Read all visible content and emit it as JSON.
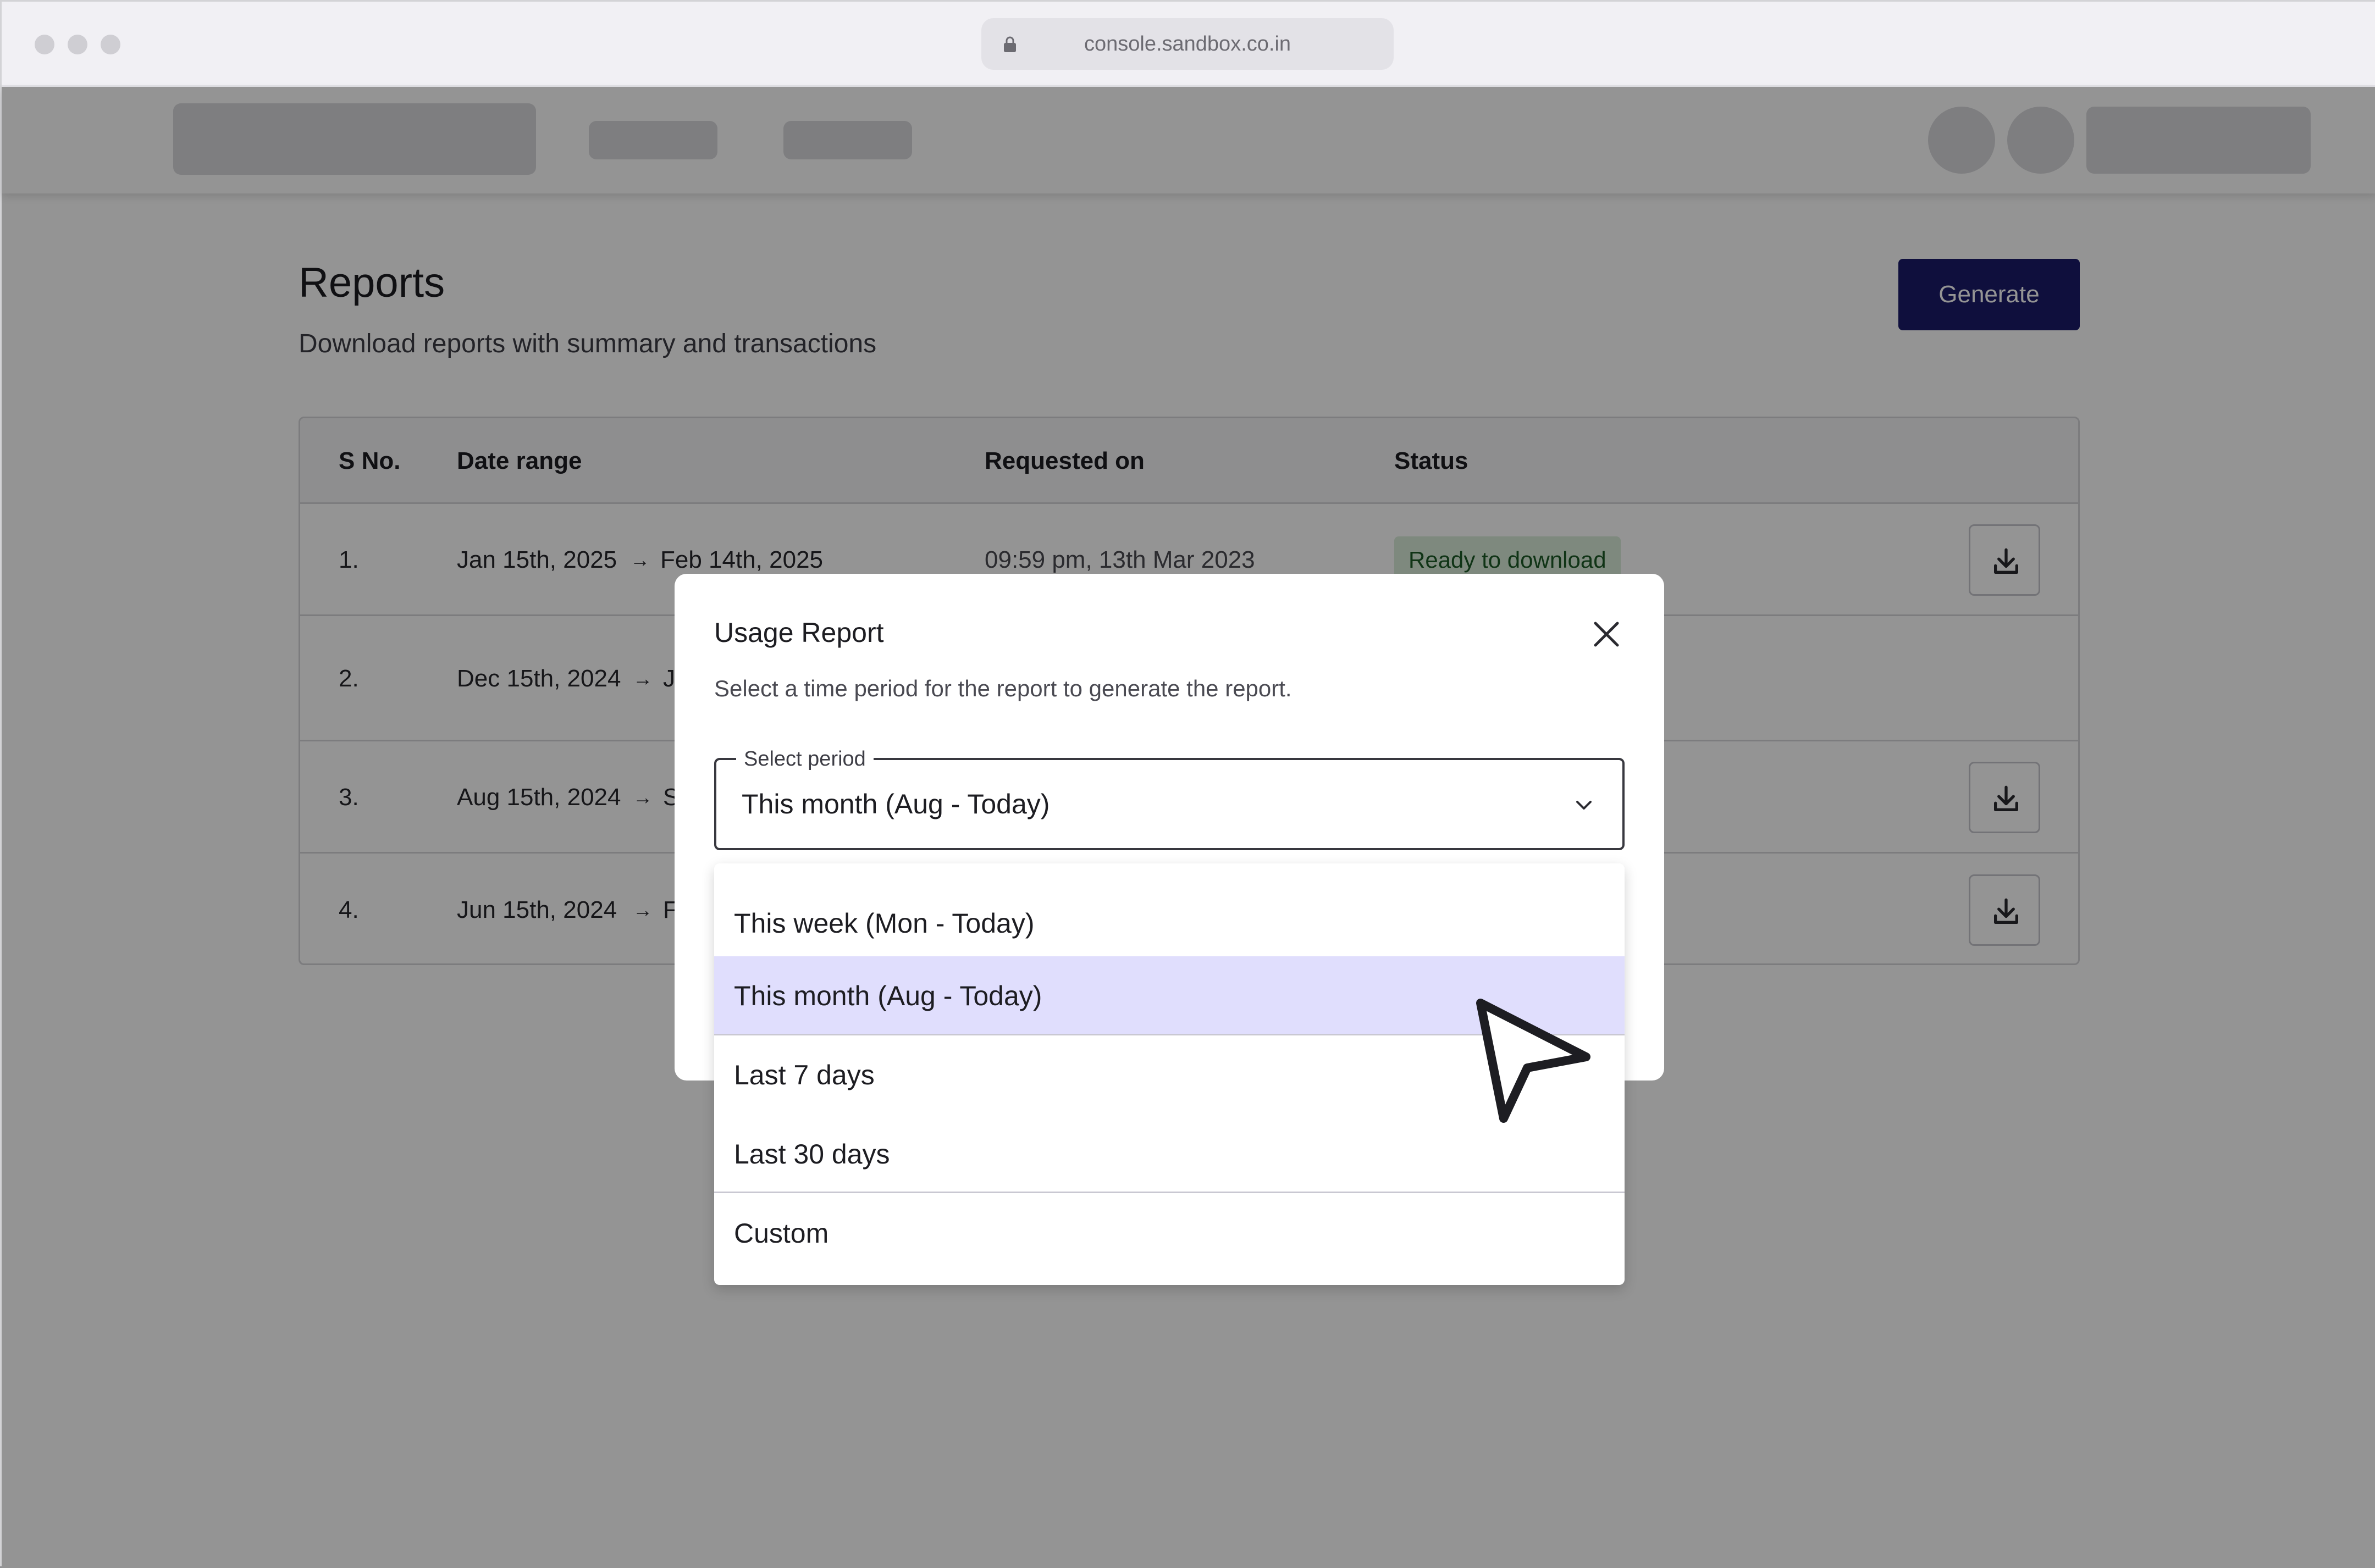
{
  "browser": {
    "url": "console.sandbox.co.in"
  },
  "page": {
    "title": "Reports",
    "subtitle": "Download reports with summary and transactions",
    "generate_label": "Generate"
  },
  "table": {
    "headers": [
      "S No.",
      "Date range",
      "Requested on",
      "Status"
    ],
    "rows": [
      {
        "sno": "1.",
        "from": "Jan 15th, 2025",
        "arrow": "→",
        "to": "Feb 14th, 2025",
        "requested": "09:59 pm, 13th Mar 2023",
        "status": "Ready to download"
      },
      {
        "sno": "2.",
        "from": "Dec 15th, 2024",
        "arrow": "→",
        "to": "J"
      },
      {
        "sno": "3.",
        "from": "Aug 15th, 2024",
        "arrow": "→",
        "to": "S"
      },
      {
        "sno": "4.",
        "from": "Jun 15th, 2024",
        "arrow": "→",
        "to": "Fe"
      }
    ]
  },
  "modal": {
    "title": "Usage Report",
    "description": "Select a time period for the report to generate the report.",
    "select_label": "Select period",
    "select_value": "This month (Aug - Today)",
    "options": [
      "This week (Mon - Today)",
      "This month (Aug - Today)",
      "Last 7 days",
      "Last 30 days",
      "Custom"
    ],
    "selected_index": 1
  },
  "icons": {
    "lock": "lock-icon",
    "close": "close-icon",
    "chevron": "chevron-down-icon",
    "download": "download-icon",
    "cursor": "cursor-arrow-icon"
  },
  "colors": {
    "primary": "#1a1a6a",
    "selected_option": "#e0defd",
    "status_badge_bg": "#d9ecd9",
    "status_badge_text": "#1c5a26"
  }
}
